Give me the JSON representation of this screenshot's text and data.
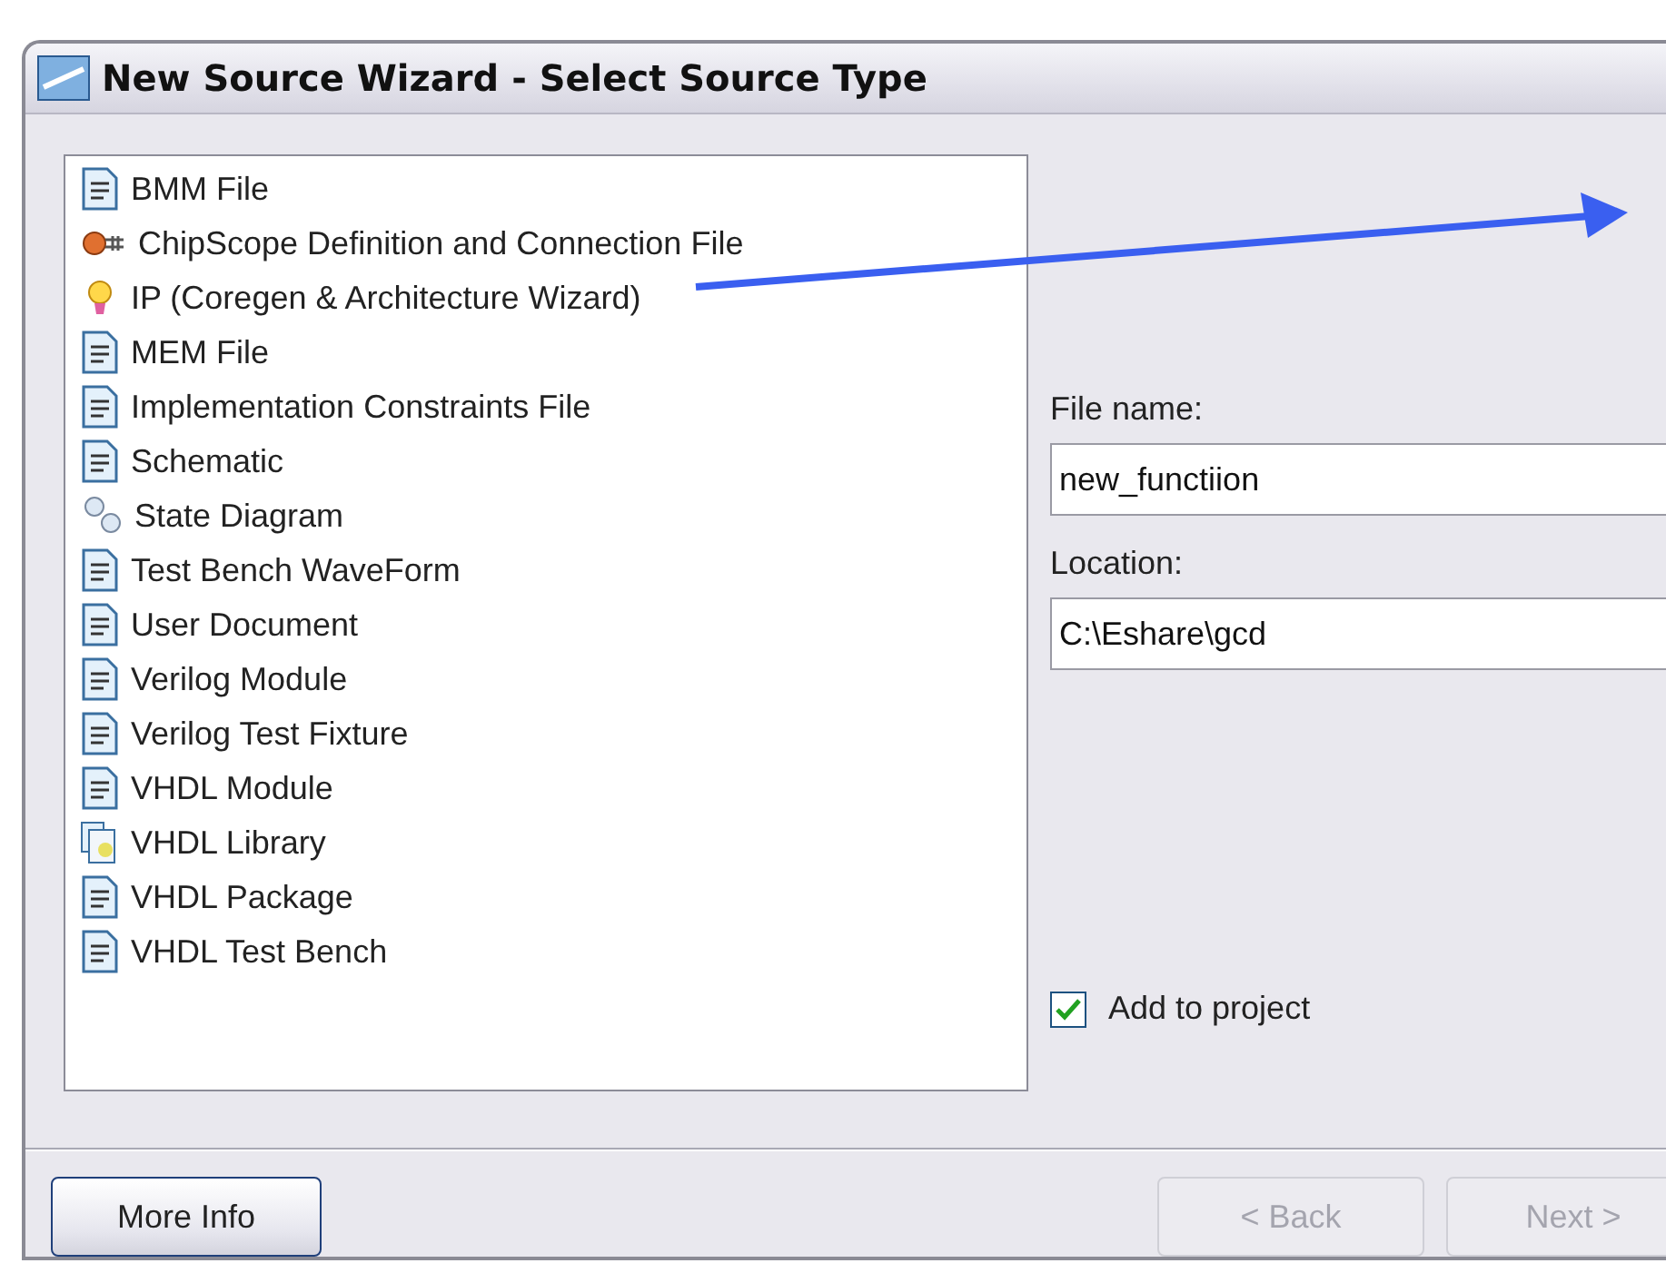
{
  "window": {
    "title": "New Source Wizard - Select Source Type"
  },
  "source_types": [
    {
      "label": "BMM File",
      "kind": "doc",
      "selected": false
    },
    {
      "label": "ChipScope Definition and Connection File",
      "kind": "probe",
      "selected": false
    },
    {
      "label": "IP (Coregen & Architecture Wizard)",
      "kind": "bulb",
      "selected": false
    },
    {
      "label": "MEM File",
      "kind": "doc",
      "selected": false
    },
    {
      "label": "Implementation Constraints File",
      "kind": "doc",
      "selected": false
    },
    {
      "label": "Schematic",
      "kind": "doc",
      "selected": false
    },
    {
      "label": "State Diagram",
      "kind": "bubbles",
      "selected": false
    },
    {
      "label": "Test Bench WaveForm",
      "kind": "doc",
      "selected": false
    },
    {
      "label": "User Document",
      "kind": "doc",
      "selected": false
    },
    {
      "label": "Verilog Module",
      "kind": "doc",
      "selected": false
    },
    {
      "label": "Verilog Test Fixture",
      "kind": "doc",
      "selected": false
    },
    {
      "label": "VHDL Module",
      "kind": "doc",
      "selected": false
    },
    {
      "label": "VHDL Library",
      "kind": "stack",
      "selected": false
    },
    {
      "label": "VHDL Package",
      "kind": "doc",
      "selected": false
    },
    {
      "label": "VHDL Test Bench",
      "kind": "doc",
      "selected": false
    }
  ],
  "file_name": {
    "label": "File name:",
    "value": "new_functiion"
  },
  "location": {
    "label": "Location:",
    "value": "C:\\Eshare\\gcd"
  },
  "add_to_project": {
    "label": "Add to project",
    "checked": true
  },
  "buttons": [
    {
      "label": "More Info",
      "disabled": false
    },
    {
      "label": "< Back",
      "disabled": true
    },
    {
      "label": "Next >",
      "disabled": true
    }
  ]
}
